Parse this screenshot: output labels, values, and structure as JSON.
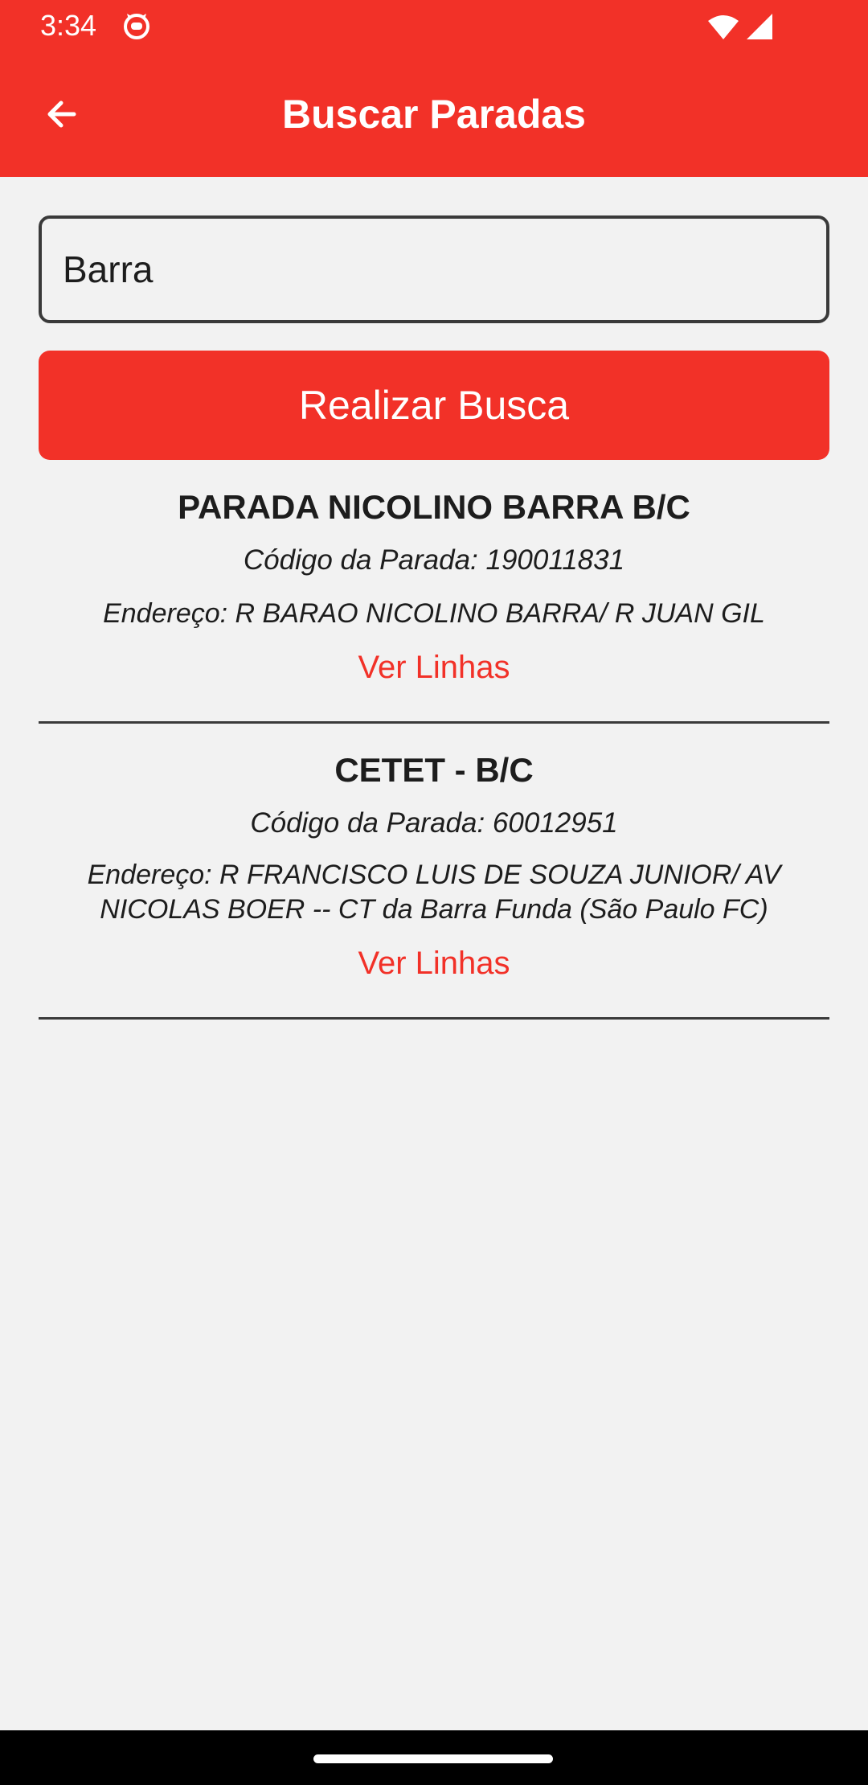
{
  "status_bar": {
    "time": "3:34",
    "icons": [
      "cat-notification-icon",
      "wifi-icon",
      "signal-icon"
    ]
  },
  "app_bar": {
    "title": "Buscar Paradas",
    "back_icon": "arrow-back-icon"
  },
  "search": {
    "value": "Barra",
    "button_label": "Realizar Busca"
  },
  "results": [
    {
      "name": "PARADA NICOLINO BARRA B/C",
      "code_line": "Código da Parada: 190011831",
      "address_line": "Endereço: R BARAO NICOLINO BARRA/ R JUAN GIL",
      "link_label": "Ver Linhas"
    },
    {
      "name": "CETET - B/C",
      "code_line": "Código da Parada: 60012951",
      "address_line": "Endereço: R FRANCISCO LUIS DE SOUZA JUNIOR/ AV NICOLAS BOER -- CT da Barra Funda (São Paulo FC)",
      "link_label": "Ver Linhas"
    }
  ],
  "colors": {
    "primary": "#f23128",
    "background": "#f2f2f2",
    "text": "#1d1d1d",
    "border": "#3a3a3a"
  }
}
